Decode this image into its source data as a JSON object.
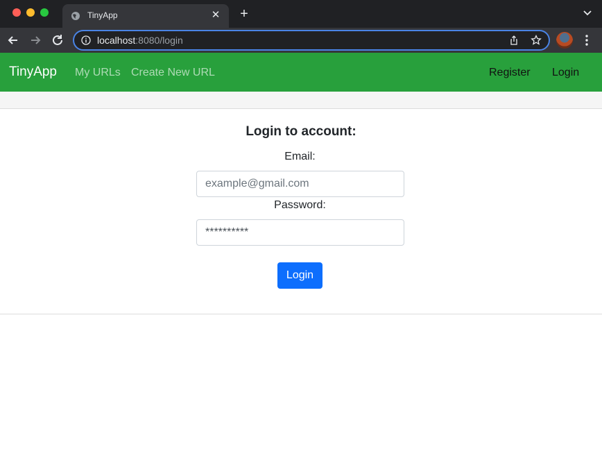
{
  "browser": {
    "tab_title": "TinyApp",
    "tab_close": "✕",
    "new_tab": "+",
    "url_host": "localhost",
    "url_path": ":8080/login"
  },
  "navbar": {
    "brand": "TinyApp",
    "links": [
      "My URLs",
      "Create New URL"
    ],
    "register": "Register",
    "login": "Login",
    "bg_color": "#28a03c"
  },
  "login_form": {
    "title": "Login to account:",
    "email_label": "Email:",
    "email_placeholder": "example@gmail.com",
    "password_label": "Password:",
    "password_value": "**********",
    "submit_label": "Login",
    "button_color": "#0d6efd"
  }
}
